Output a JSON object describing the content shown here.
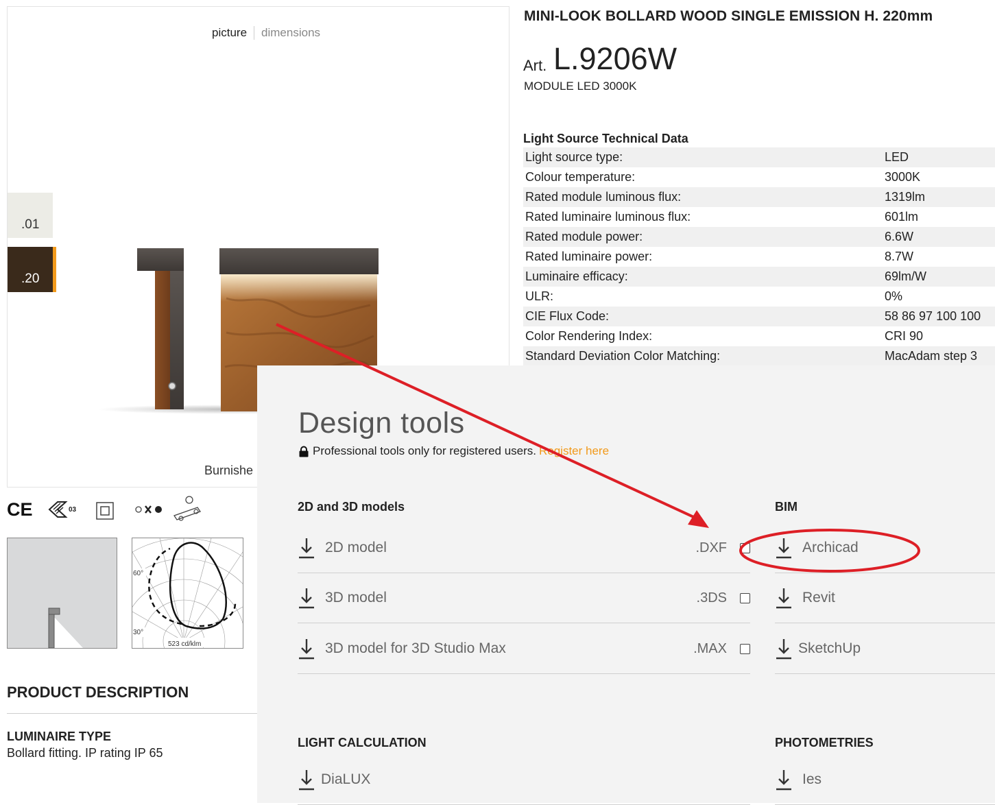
{
  "image_panel": {
    "tabs": [
      {
        "label": "picture"
      },
      {
        "label": "dimensions"
      }
    ],
    "finishes": [
      {
        "code": ".01",
        "color": "#ecece6"
      },
      {
        "code": ".20",
        "color": "#3a2a1b"
      }
    ],
    "selected_finish_accent": "#f29a1b",
    "caption": "Burnishe"
  },
  "product": {
    "title": "MINI-LOOK BOLLARD WOOD SINGLE EMISSION H. 220mm",
    "art_prefix": "Art.",
    "art_code": "L.9206W",
    "module": "MODULE LED 3000K"
  },
  "tech_data": {
    "title": "Light Source Technical Data",
    "rows": [
      {
        "label": "Light source type:",
        "value": "LED"
      },
      {
        "label": "Colour temperature:",
        "value": "3000K"
      },
      {
        "label": "Rated module luminous flux:",
        "value": "1319lm"
      },
      {
        "label": "Rated luminaire luminous flux:",
        "value": "601lm"
      },
      {
        "label": "Rated module power:",
        "value": "6.6W"
      },
      {
        "label": "Rated luminaire power:",
        "value": "8.7W"
      },
      {
        "label": "Luminaire efficacy:",
        "value": "69lm/W"
      },
      {
        "label": "ULR:",
        "value": "0%"
      },
      {
        "label": "CIE Flux Code:",
        "value": "58 86 97 100 100"
      },
      {
        "label": "Color Rendering Index:",
        "value": "CRI 90"
      },
      {
        "label": "Standard Deviation Color Matching:",
        "value": "MacAdam step 3"
      }
    ]
  },
  "certifications": {
    "ce": "CE",
    "ip_class": "03"
  },
  "photometric_drawing": {
    "angle_60": "60°",
    "angle_30": "30°",
    "intensity": "523 cd/klm"
  },
  "description": {
    "title": "PRODUCT DESCRIPTION",
    "luminaire_type_label": "LUMINAIRE TYPE",
    "luminaire_type_value": "Bollard fitting. IP rating IP 65"
  },
  "design_tools": {
    "title": "Design tools",
    "note": "Professional tools only for registered users.",
    "register_link": "Register here",
    "models": {
      "heading": "2D and 3D models",
      "items": [
        {
          "label": "2D model",
          "ext": ".DXF"
        },
        {
          "label": "3D model",
          "ext": ".3DS"
        },
        {
          "label": "3D model for 3D Studio Max",
          "ext": ".MAX"
        }
      ]
    },
    "bim": {
      "heading": "BIM",
      "items": [
        {
          "label": "Archicad"
        },
        {
          "label": "Revit"
        },
        {
          "label": "SketchUp"
        }
      ]
    },
    "light_calc": {
      "heading": "LIGHT CALCULATION",
      "items": [
        {
          "label": "DiaLUX"
        }
      ]
    },
    "photometries": {
      "heading": "PHOTOMETRIES",
      "items": [
        {
          "label": "Ies"
        }
      ]
    }
  },
  "annotation_color": "#dd1f26"
}
